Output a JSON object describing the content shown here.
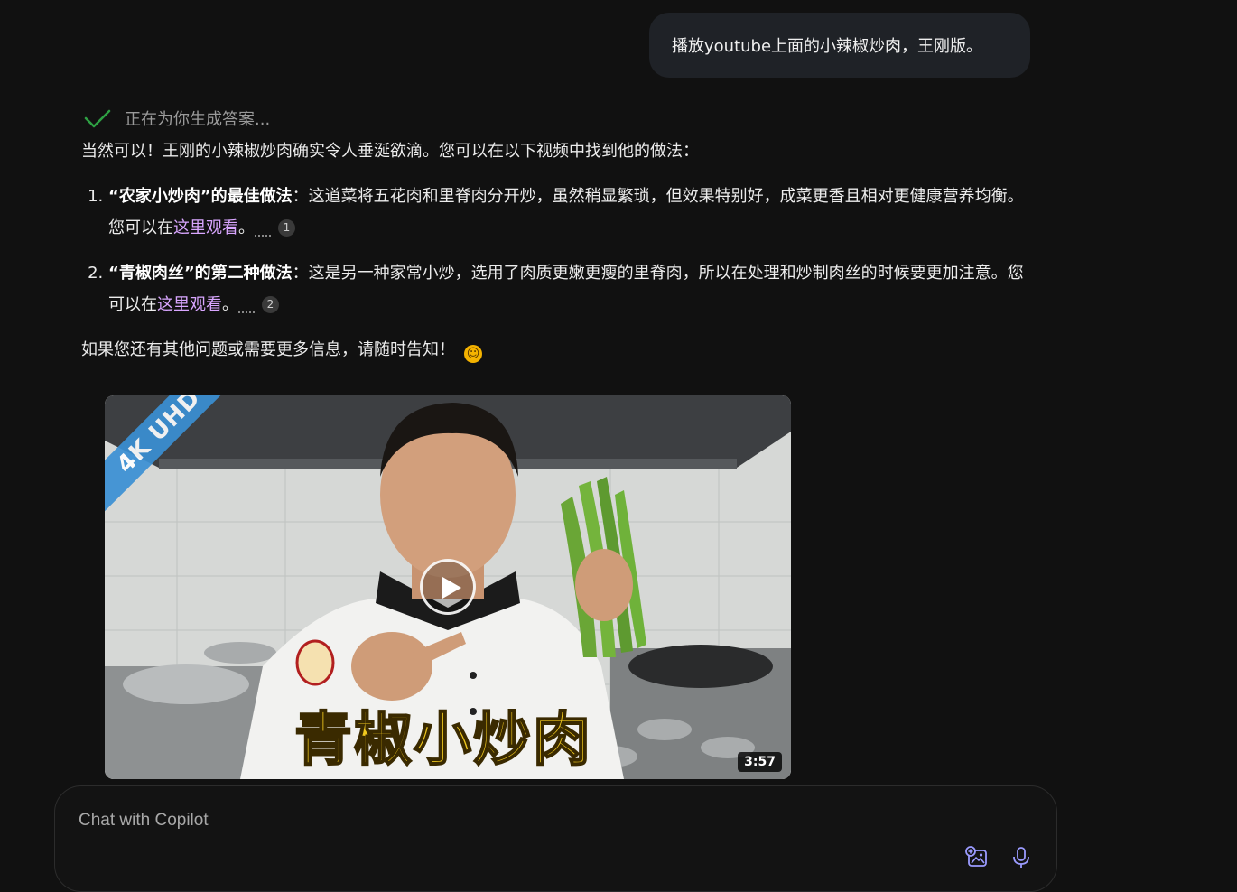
{
  "user_message": {
    "text": "播放youtube上面的小辣椒炒肉，王刚版。"
  },
  "status": {
    "text": "正在为你生成答案..."
  },
  "answer": {
    "intro": "当然可以！王刚的小辣椒炒肉确实令人垂涎欲滴。您可以在以下视频中找到他的做法：",
    "items": [
      {
        "number": "1.",
        "title": "“农家小炒肉”的最佳做法",
        "body": "：这道菜将五花肉和里脊肉分开炒，虽然稍显繁琐，但效果特别好，成菜更香且相对更健康营养均衡。您可以在",
        "link": "这里观看",
        "end": "。",
        "cite": "1"
      },
      {
        "number": "2.",
        "title": "“青椒肉丝”的第二种做法",
        "body": "：这是另一种家常小炒，选用了肉质更嫩更瘦的里脊肉，所以在处理和炒制肉丝的时候要更加注意。您可以在",
        "link": "这里观看",
        "end": "。",
        "cite": "2"
      }
    ],
    "outro": "如果您还有其他问题或需要更多信息，请随时告知！",
    "emoji": "smiling-face-emoji"
  },
  "video": {
    "badge": "4K UHD",
    "caption": "青椒小炒肉",
    "duration": "3:57",
    "play_icon": "play-icon"
  },
  "composer": {
    "placeholder": "Chat with Copilot",
    "value": "",
    "image_icon": "add-image-icon",
    "mic_icon": "microphone-icon"
  },
  "colors": {
    "background": "#111111",
    "user_bubble": "#1f2227",
    "link": "#d9a6ff",
    "check": "#2ea043",
    "composer_icon": "#9b9bff"
  }
}
